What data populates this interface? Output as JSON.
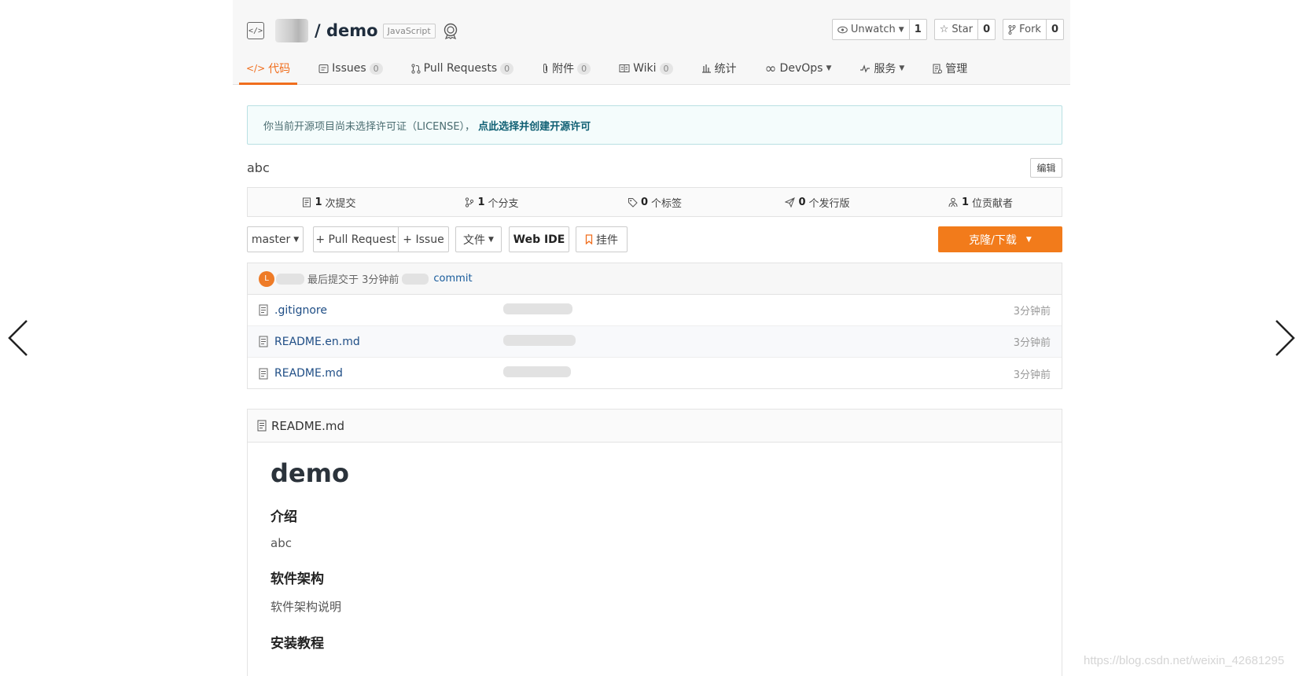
{
  "repo": {
    "name": "/ demo",
    "language": "JavaScript",
    "actions": [
      {
        "label": "Unwatch",
        "count": "1"
      },
      {
        "label": "Star",
        "count": "0"
      },
      {
        "label": "Fork",
        "count": "0"
      }
    ]
  },
  "tabs": [
    {
      "label": "代码",
      "count": ""
    },
    {
      "label": "Issues",
      "count": "0"
    },
    {
      "label": "Pull Requests",
      "count": "0"
    },
    {
      "label": "附件",
      "count": "0"
    },
    {
      "label": "Wiki",
      "count": "0"
    },
    {
      "label": "统计",
      "count": ""
    },
    {
      "label": "DevOps",
      "count": ""
    },
    {
      "label": "服务",
      "count": ""
    },
    {
      "label": "管理",
      "count": ""
    }
  ],
  "license": {
    "text": "你当前开源项目尚未选择许可证（LICENSE），",
    "link": "点此选择并创建开源许可"
  },
  "description": "abc",
  "edit_label": "编辑",
  "stats": [
    {
      "value": "1",
      "label": "次提交"
    },
    {
      "value": "1",
      "label": "个分支"
    },
    {
      "value": "0",
      "label": "个标签"
    },
    {
      "value": "0",
      "label": "个发行版"
    },
    {
      "value": "1",
      "label": "位贡献者"
    }
  ],
  "toolbar": {
    "branch": "master",
    "pull_request": "+ Pull Request",
    "issue": "+ Issue",
    "files": "文件",
    "web_ide": "Web IDE",
    "widget": "挂件",
    "clone": "克隆/下载"
  },
  "last_commit": {
    "avatar_letter": "L",
    "text": "最后提交于 3分钟前",
    "link": "commit"
  },
  "files": [
    {
      "name": ".gitignore",
      "time": "3分钟前"
    },
    {
      "name": "README.en.md",
      "time": "3分钟前"
    },
    {
      "name": "README.md",
      "time": "3分钟前"
    }
  ],
  "readme": {
    "filename": "README.md",
    "title": "demo",
    "h_intro": "介绍",
    "intro": "abc",
    "h_arch": "软件架构",
    "arch": "软件架构说明",
    "h_install": "安装教程"
  },
  "watermark": "https://blog.csdn.net/weixin_42681295"
}
